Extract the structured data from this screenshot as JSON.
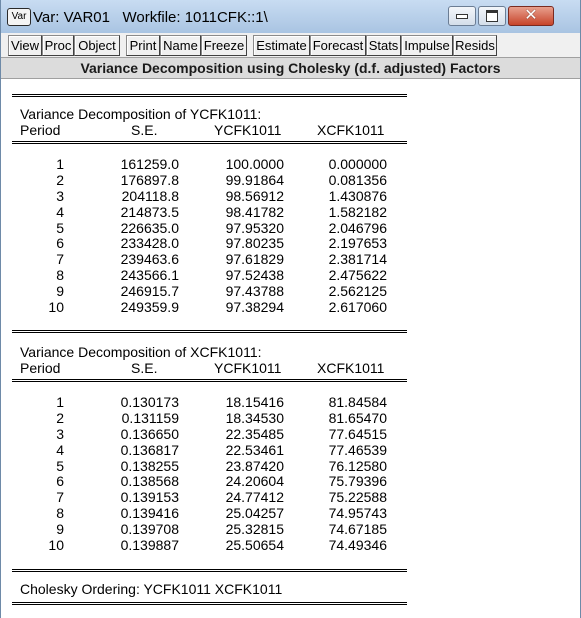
{
  "window": {
    "icon_label": "Var",
    "title": "Var: VAR01   Workfile: 1011CFK::1\\"
  },
  "toolbar": [
    {
      "id": "view",
      "label": "View"
    },
    {
      "id": "proc",
      "label": "Proc"
    },
    {
      "id": "object",
      "label": "Object"
    },
    {
      "id": "print",
      "label": "Print"
    },
    {
      "id": "name",
      "label": "Name"
    },
    {
      "id": "freeze",
      "label": "Freeze"
    },
    {
      "id": "estimate",
      "label": "Estimate"
    },
    {
      "id": "forecast",
      "label": "Forecast"
    },
    {
      "id": "stats",
      "label": "Stats"
    },
    {
      "id": "impulse",
      "label": "Impulse"
    },
    {
      "id": "resids",
      "label": "Resids"
    }
  ],
  "header": "Variance Decomposition using Cholesky (d.f. adjusted) Factors",
  "tables": [
    {
      "title": "Variance Decomposition of YCFK1011:",
      "columns": [
        "Period",
        "S.E.",
        "YCFK1011",
        "XCFK1011"
      ],
      "rows": [
        [
          "1",
          "161259.0",
          "100.0000",
          "0.000000"
        ],
        [
          "2",
          "176897.8",
          "99.91864",
          "0.081356"
        ],
        [
          "3",
          "204118.8",
          "98.56912",
          "1.430876"
        ],
        [
          "4",
          "214873.5",
          "98.41782",
          "1.582182"
        ],
        [
          "5",
          "226635.0",
          "97.95320",
          "2.046796"
        ],
        [
          "6",
          "233428.0",
          "97.80235",
          "2.197653"
        ],
        [
          "7",
          "239463.6",
          "97.61829",
          "2.381714"
        ],
        [
          "8",
          "243566.1",
          "97.52438",
          "2.475622"
        ],
        [
          "9",
          "246915.7",
          "97.43788",
          "2.562125"
        ],
        [
          "10",
          "249359.9",
          "97.38294",
          "2.617060"
        ]
      ]
    },
    {
      "title": "Variance Decomposition of XCFK1011:",
      "columns": [
        "Period",
        "S.E.",
        "YCFK1011",
        "XCFK1011"
      ],
      "rows": [
        [
          "1",
          "0.130173",
          "18.15416",
          "81.84584"
        ],
        [
          "2",
          "0.131159",
          "18.34530",
          "81.65470"
        ],
        [
          "3",
          "0.136650",
          "22.35485",
          "77.64515"
        ],
        [
          "4",
          "0.136817",
          "22.53461",
          "77.46539"
        ],
        [
          "5",
          "0.138255",
          "23.87420",
          "76.12580"
        ],
        [
          "6",
          "0.138568",
          "24.20604",
          "75.79396"
        ],
        [
          "7",
          "0.139153",
          "24.77412",
          "75.22588"
        ],
        [
          "8",
          "0.139416",
          "25.04257",
          "74.95743"
        ],
        [
          "9",
          "0.139708",
          "25.32815",
          "74.67185"
        ],
        [
          "10",
          "0.139887",
          "25.50654",
          "74.49346"
        ]
      ]
    }
  ],
  "footer": "Cholesky Ordering: YCFK1011 XCFK1011"
}
